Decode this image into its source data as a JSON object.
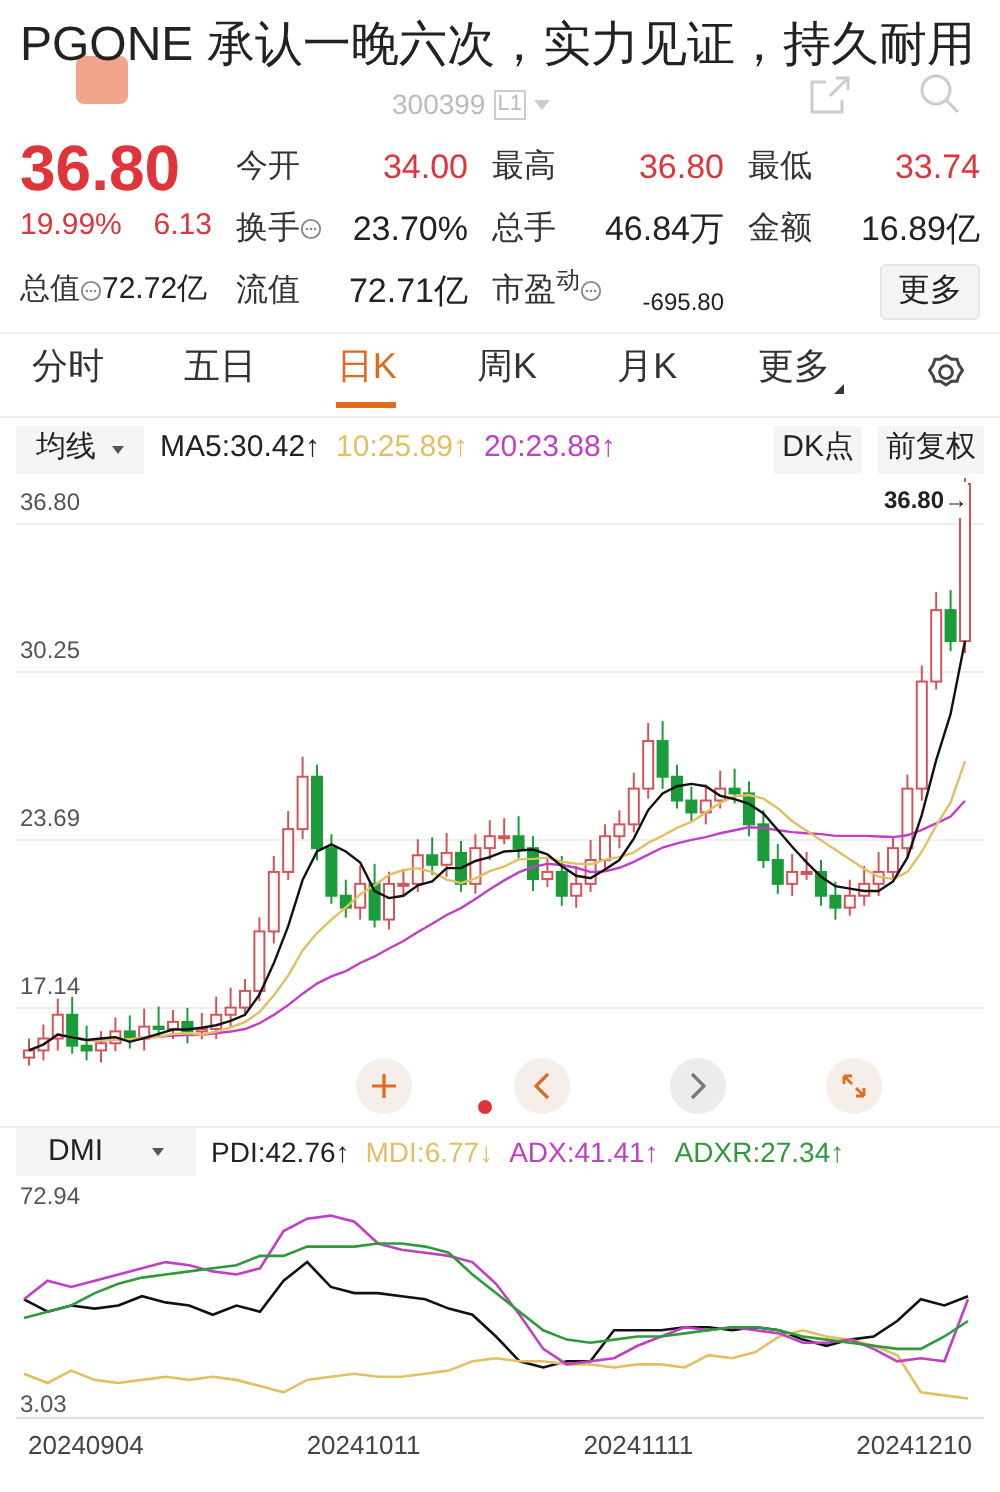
{
  "caption": "PGONE 承认一晚六次，实力见证，持久耐用",
  "header": {
    "code": "300399",
    "badge": "L1"
  },
  "quote": {
    "price": "36.80",
    "change_pct": "19.99%",
    "change": "6.13"
  },
  "total_value": {
    "label": "总值",
    "value": "72.72亿",
    "info": true
  },
  "stats": [
    {
      "label": "今开",
      "value": "34.00",
      "kind": "price",
      "color": "#e0343b",
      "info": false
    },
    {
      "label": "最高",
      "value": "36.80",
      "kind": "price",
      "color": "#e0343b",
      "info": false
    },
    {
      "label": "最低",
      "value": "33.74",
      "kind": "price",
      "color": "#e0343b",
      "info": false
    },
    {
      "label": "换手",
      "value": "23.70%",
      "kind": "price",
      "color": "#222222",
      "info": true
    },
    {
      "label": "总手",
      "value": "46.84万",
      "kind": "price",
      "color": "#222222",
      "info": false
    },
    {
      "label": "金额",
      "value": "16.89亿",
      "kind": "price",
      "color": "#222222",
      "info": false
    },
    {
      "label": "流值",
      "value": "72.71亿",
      "kind": "price",
      "color": "#222222",
      "info": false
    },
    {
      "label": "市盈$^{动}$",
      "value": "-695.80",
      "kind": "ratio",
      "color": "#222222",
      "info": true
    }
  ],
  "more_button": "更多",
  "tabs": [
    {
      "label": "分时",
      "selected": false,
      "dropdown": false
    },
    {
      "label": "五日",
      "selected": false,
      "dropdown": false
    },
    {
      "label": "日K",
      "selected": true,
      "dropdown": false
    },
    {
      "label": "周K",
      "selected": false,
      "dropdown": false
    },
    {
      "label": "月K",
      "selected": false,
      "dropdown": false
    },
    {
      "label": "更多",
      "selected": false,
      "dropdown": true
    }
  ],
  "ma_bar": {
    "selector": "均线",
    "items": [
      {
        "text": "MA5:30.42",
        "arrow": "↑",
        "color": "#222222"
      },
      {
        "text": "10:25.89",
        "arrow": "↑",
        "color": "#e3bf62"
      },
      {
        "text": "20:23.88",
        "arrow": "↑",
        "color": "#c13fc4"
      }
    ],
    "dk": "DK点",
    "adjust": "前复权"
  },
  "main_chart": {
    "y_labels": [
      "36.80",
      "30.25",
      "23.69",
      "17.14"
    ],
    "last_tag": "36.80→"
  },
  "dmi_bar": {
    "selector": "DMI",
    "items": [
      {
        "text": "PDI:42.76",
        "arrow": "↑",
        "color": "#222222"
      },
      {
        "text": "MDI:6.77",
        "arrow": "↓",
        "color": "#e3bf62"
      },
      {
        "text": "ADX:41.41",
        "arrow": "↑",
        "color": "#c13fc4"
      },
      {
        "text": "ADXR:27.34",
        "arrow": "↑",
        "color": "#2e9a3a"
      }
    ]
  },
  "dmi_chart": {
    "y_labels": [
      "72.94",
      "3.03"
    ],
    "dates": [
      "20240904",
      "20241011",
      "20241111",
      "20241210"
    ]
  }
}
